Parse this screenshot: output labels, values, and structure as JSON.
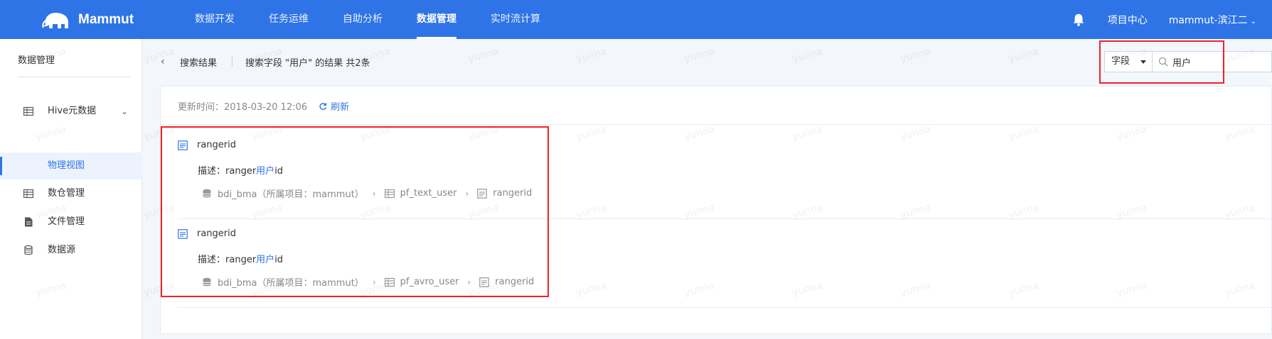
{
  "app": {
    "name": "Mammut"
  },
  "nav": {
    "items": [
      {
        "label": "数据开发",
        "active": false
      },
      {
        "label": "任务运维",
        "active": false
      },
      {
        "label": "自助分析",
        "active": false
      },
      {
        "label": "数据管理",
        "active": true
      },
      {
        "label": "实时流计算",
        "active": false
      }
    ]
  },
  "header_right": {
    "bell_icon": "bell-icon",
    "project_center": "项目中心",
    "user": "mammut-滨江二"
  },
  "sidebar": {
    "title": "数据管理",
    "items": [
      {
        "label": "Hive元数据",
        "icon": "table-icon"
      },
      {
        "label": "物理视图"
      },
      {
        "label": "数仓管理",
        "icon": "table-icon"
      },
      {
        "label": "文件管理",
        "icon": "file-icon"
      },
      {
        "label": "数据源",
        "icon": "database-icon"
      }
    ]
  },
  "crumb": {
    "title": "搜索结果",
    "desc": "搜索字段 \"用户\" 的结果 共2条"
  },
  "search": {
    "type": "字段",
    "value": "用户"
  },
  "card": {
    "update_time": "更新时间：2018-03-20 12:06",
    "refresh": "刷新"
  },
  "results": [
    {
      "name": "rangerid",
      "desc_prefix": "描述：",
      "desc_pre": "ranger",
      "desc_hl": "用户",
      "desc_post": "id",
      "db": "bdi_bma（所属项目：mammut）",
      "table": "pf_text_user",
      "field": "rangerid"
    },
    {
      "name": "rangerid",
      "desc_prefix": "描述：",
      "desc_pre": "ranger",
      "desc_hl": "用户",
      "desc_post": "id",
      "db": "bdi_bma（所属项目：mammut）",
      "table": "pf_avro_user",
      "field": "rangerid"
    }
  ],
  "watermark": "yunna",
  "colors": {
    "primary": "#2f74e6",
    "highlight_box": "#f2202a"
  }
}
